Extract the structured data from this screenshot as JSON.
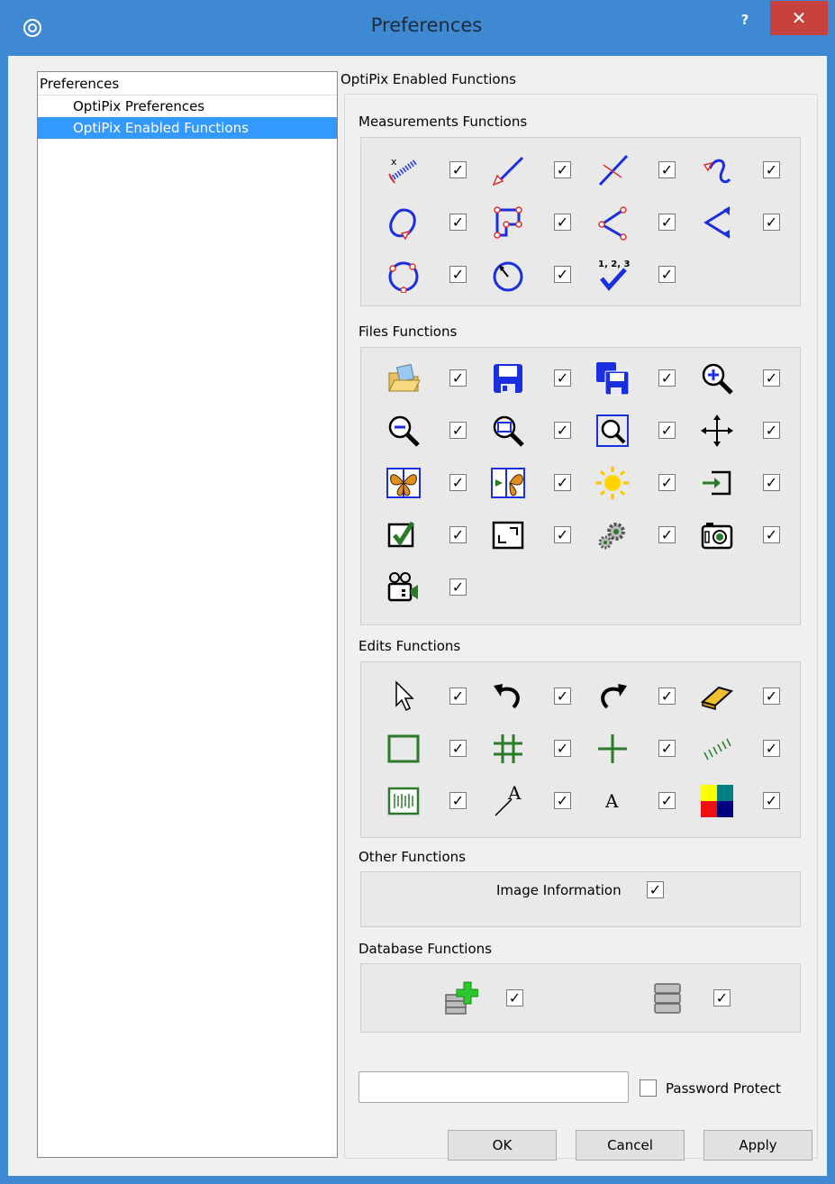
{
  "window": {
    "title": "Preferences",
    "help_label": "?",
    "close_label": "✕",
    "app_icon": "target-icon"
  },
  "tree": {
    "header": "Preferences",
    "items": [
      {
        "label": "OptiPix Preferences",
        "selected": false
      },
      {
        "label": "OptiPix Enabled Functions",
        "selected": true
      }
    ]
  },
  "panel": {
    "title": "OptiPix Enabled Functions",
    "sections": {
      "measurements": {
        "label": "Measurements Functions",
        "items": [
          {
            "icon": "calibrate-ruler-icon",
            "checked": true
          },
          {
            "icon": "line-measure-icon",
            "checked": true
          },
          {
            "icon": "crossed-line-icon",
            "checked": true
          },
          {
            "icon": "curve-length-icon",
            "checked": true
          },
          {
            "icon": "freehand-area-icon",
            "checked": true
          },
          {
            "icon": "polygon-area-icon",
            "checked": true
          },
          {
            "icon": "angle-three-point-icon",
            "checked": true
          },
          {
            "icon": "angle-arrows-icon",
            "checked": true
          },
          {
            "icon": "circle-three-point-icon",
            "checked": true
          },
          {
            "icon": "circle-radius-icon",
            "checked": true
          },
          {
            "icon": "count-checkmark-icon",
            "count_label": "1, 2, 3",
            "checked": true
          }
        ]
      },
      "files": {
        "label": "Files Functions",
        "items": [
          {
            "icon": "open-image-icon",
            "checked": true
          },
          {
            "icon": "save-icon",
            "checked": true
          },
          {
            "icon": "save-all-icon",
            "checked": true
          },
          {
            "icon": "zoom-in-icon",
            "checked": true
          },
          {
            "icon": "zoom-out-icon",
            "checked": true
          },
          {
            "icon": "zoom-window-icon",
            "checked": true
          },
          {
            "icon": "zoom-fit-icon",
            "checked": true
          },
          {
            "icon": "pan-move-icon",
            "checked": true
          },
          {
            "icon": "butterfly-compare-icon",
            "checked": true
          },
          {
            "icon": "butterfly-split-icon",
            "checked": true
          },
          {
            "icon": "brightness-sun-icon",
            "checked": true
          },
          {
            "icon": "import-icon",
            "checked": true
          },
          {
            "icon": "check-box-icon",
            "checked": true
          },
          {
            "icon": "fullscreen-icon",
            "checked": true
          },
          {
            "icon": "settings-gears-icon",
            "checked": true
          },
          {
            "icon": "camera-icon",
            "checked": true
          },
          {
            "icon": "video-camera-icon",
            "checked": true
          }
        ]
      },
      "edits": {
        "label": "Edits Functions",
        "items": [
          {
            "icon": "pointer-arrow-icon",
            "checked": true
          },
          {
            "icon": "undo-icon",
            "checked": true
          },
          {
            "icon": "redo-icon",
            "checked": true
          },
          {
            "icon": "eraser-icon",
            "checked": true
          },
          {
            "icon": "rectangle-icon",
            "checked": true
          },
          {
            "icon": "grid-icon",
            "checked": true
          },
          {
            "icon": "crosshair-icon",
            "checked": true
          },
          {
            "icon": "hatch-lines-icon",
            "checked": true
          },
          {
            "icon": "scale-bar-icon",
            "checked": true
          },
          {
            "icon": "text-arrow-icon",
            "text": "A",
            "checked": true
          },
          {
            "icon": "text-icon",
            "text": "A",
            "checked": true
          },
          {
            "icon": "color-palette-icon",
            "checked": true
          }
        ]
      },
      "other": {
        "label": "Other Functions",
        "item_label": "Image Information",
        "checked": true
      },
      "database": {
        "label": "Database Functions",
        "items": [
          {
            "icon": "database-add-icon",
            "checked": true
          },
          {
            "icon": "database-icon",
            "checked": true
          }
        ]
      }
    },
    "password": {
      "value": "",
      "label": "Password Protect",
      "checked": false
    }
  },
  "check_glyph": "✓",
  "buttons": {
    "ok": "OK",
    "cancel": "Cancel",
    "apply": "Apply"
  },
  "colors": {
    "title_bar": "#3f89d3",
    "close_button": "#c7423c",
    "selection": "#3399ff",
    "icon_blue": "#1a2fe0",
    "icon_red": "#e03030",
    "icon_green": "#2a7a2a"
  }
}
